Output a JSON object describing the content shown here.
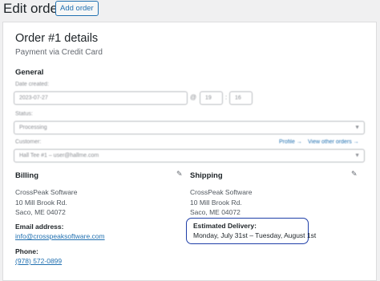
{
  "header": {
    "title": "Edit order",
    "add_button": "Add order"
  },
  "order": {
    "title": "Order #1 details",
    "payment": "Payment via Credit Card"
  },
  "general": {
    "heading": "General",
    "date_label": "Date created:",
    "date_value": "2023-07-27",
    "at": "@",
    "hour": "19",
    "minute": "16",
    "status_label": "Status:",
    "status_value": "Processing",
    "customer_label": "Customer:",
    "customer_value": "Hall Tee #1 – user@hallme.com",
    "profile_link": "Profile →",
    "view_orders_link": "View other orders →"
  },
  "billing": {
    "heading": "Billing",
    "address": [
      "CrossPeak Software",
      "10 Mill Brook Rd.",
      "Saco, ME 04072"
    ],
    "email_label": "Email address:",
    "email": "info@crosspeaksoftware.com",
    "phone_label": "Phone:",
    "phone": "(978) 572-0899"
  },
  "shipping": {
    "heading": "Shipping",
    "address": [
      "CrossPeak Software",
      "10 Mill Brook Rd.",
      "Saco, ME 04072"
    ],
    "delivery_label": "Estimated Delivery:",
    "delivery_value": "Monday, July 31st – Tuesday, August 1st"
  },
  "colors": {
    "accent": "#2271b1",
    "highlight_border": "#1f3fa8"
  },
  "icons": {
    "edit": "pencil-icon",
    "select": "chevron-down-icon"
  }
}
